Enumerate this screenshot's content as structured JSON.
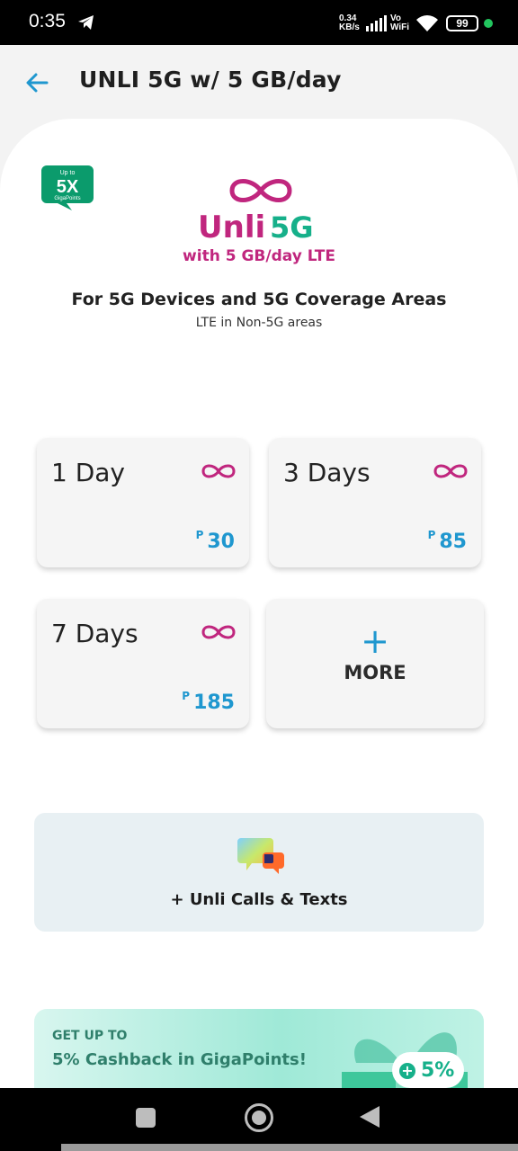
{
  "status_bar": {
    "time": "0:35",
    "speed_value": "0.34",
    "speed_unit": "KB/s",
    "vo": "Vo",
    "wifi_label": "WiFi",
    "battery": "99"
  },
  "header": {
    "title": "UNLI 5G w/ 5 GB/day"
  },
  "badge": {
    "up_to": "Up to",
    "multiplier": "5X",
    "label": "GigaPoints"
  },
  "hero": {
    "unli": "Unli",
    "five_g": "5G",
    "with_text": "with 5 GB/day LTE",
    "heading": "For 5G Devices and 5G Coverage Areas",
    "subheading": "LTE in Non-5G areas"
  },
  "options": [
    {
      "days": "1 Day",
      "currency": "P",
      "price": "30"
    },
    {
      "days": "3 Days",
      "currency": "P",
      "price": "85"
    },
    {
      "days": "7 Days",
      "currency": "P",
      "price": "185"
    }
  ],
  "more": {
    "plus": "+",
    "label": "MORE"
  },
  "addon": {
    "label": "+ Unli Calls & Texts"
  },
  "promo": {
    "kicker": "GET UP TO",
    "title": "5% Cashback in GigaPoints!",
    "pill_icon": "+",
    "pill_text": "5%"
  },
  "colors": {
    "accent_blue": "#1f97cf",
    "brand_magenta": "#c0267e",
    "brand_green": "#16b08a"
  }
}
